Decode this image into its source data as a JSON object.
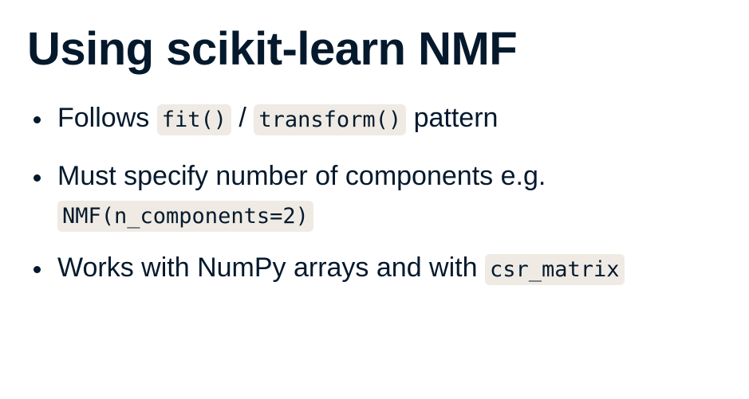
{
  "title": "Using scikit-learn NMF",
  "bullets": [
    {
      "pre": "Follows ",
      "code1": "fit()",
      "mid": " / ",
      "code2": "transform()",
      "post": " pattern"
    },
    {
      "pre": "Must specify number of components e.g.",
      "code1": "NMF(n_components=2)"
    },
    {
      "pre": "Works with NumPy arrays and with ",
      "code1": "csr_matrix"
    }
  ]
}
